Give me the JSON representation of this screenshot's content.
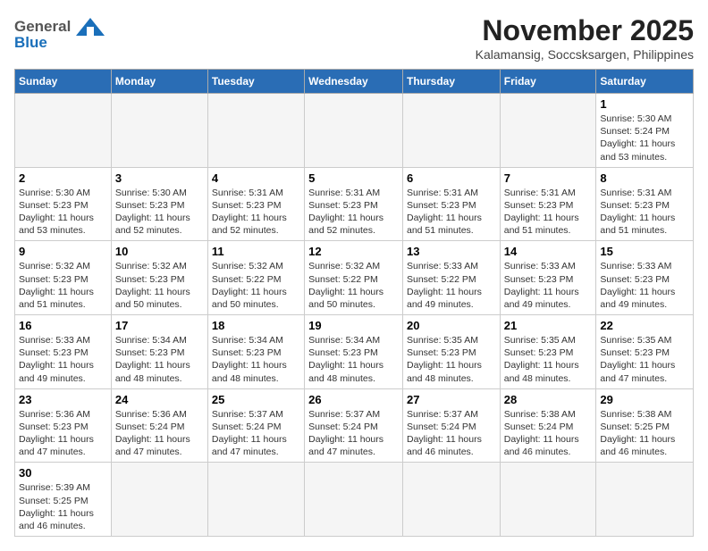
{
  "header": {
    "logo_general": "General",
    "logo_blue": "Blue",
    "month_year": "November 2025",
    "location": "Kalamansig, Soccsksargen, Philippines"
  },
  "weekdays": [
    "Sunday",
    "Monday",
    "Tuesday",
    "Wednesday",
    "Thursday",
    "Friday",
    "Saturday"
  ],
  "weeks": [
    [
      {
        "day": "",
        "info": ""
      },
      {
        "day": "",
        "info": ""
      },
      {
        "day": "",
        "info": ""
      },
      {
        "day": "",
        "info": ""
      },
      {
        "day": "",
        "info": ""
      },
      {
        "day": "",
        "info": ""
      },
      {
        "day": "1",
        "info": "Sunrise: 5:30 AM\nSunset: 5:24 PM\nDaylight: 11 hours\nand 53 minutes."
      }
    ],
    [
      {
        "day": "2",
        "info": "Sunrise: 5:30 AM\nSunset: 5:23 PM\nDaylight: 11 hours\nand 53 minutes."
      },
      {
        "day": "3",
        "info": "Sunrise: 5:30 AM\nSunset: 5:23 PM\nDaylight: 11 hours\nand 52 minutes."
      },
      {
        "day": "4",
        "info": "Sunrise: 5:31 AM\nSunset: 5:23 PM\nDaylight: 11 hours\nand 52 minutes."
      },
      {
        "day": "5",
        "info": "Sunrise: 5:31 AM\nSunset: 5:23 PM\nDaylight: 11 hours\nand 52 minutes."
      },
      {
        "day": "6",
        "info": "Sunrise: 5:31 AM\nSunset: 5:23 PM\nDaylight: 11 hours\nand 51 minutes."
      },
      {
        "day": "7",
        "info": "Sunrise: 5:31 AM\nSunset: 5:23 PM\nDaylight: 11 hours\nand 51 minutes."
      },
      {
        "day": "8",
        "info": "Sunrise: 5:31 AM\nSunset: 5:23 PM\nDaylight: 11 hours\nand 51 minutes."
      }
    ],
    [
      {
        "day": "9",
        "info": "Sunrise: 5:32 AM\nSunset: 5:23 PM\nDaylight: 11 hours\nand 51 minutes."
      },
      {
        "day": "10",
        "info": "Sunrise: 5:32 AM\nSunset: 5:23 PM\nDaylight: 11 hours\nand 50 minutes."
      },
      {
        "day": "11",
        "info": "Sunrise: 5:32 AM\nSunset: 5:22 PM\nDaylight: 11 hours\nand 50 minutes."
      },
      {
        "day": "12",
        "info": "Sunrise: 5:32 AM\nSunset: 5:22 PM\nDaylight: 11 hours\nand 50 minutes."
      },
      {
        "day": "13",
        "info": "Sunrise: 5:33 AM\nSunset: 5:22 PM\nDaylight: 11 hours\nand 49 minutes."
      },
      {
        "day": "14",
        "info": "Sunrise: 5:33 AM\nSunset: 5:23 PM\nDaylight: 11 hours\nand 49 minutes."
      },
      {
        "day": "15",
        "info": "Sunrise: 5:33 AM\nSunset: 5:23 PM\nDaylight: 11 hours\nand 49 minutes."
      }
    ],
    [
      {
        "day": "16",
        "info": "Sunrise: 5:33 AM\nSunset: 5:23 PM\nDaylight: 11 hours\nand 49 minutes."
      },
      {
        "day": "17",
        "info": "Sunrise: 5:34 AM\nSunset: 5:23 PM\nDaylight: 11 hours\nand 48 minutes."
      },
      {
        "day": "18",
        "info": "Sunrise: 5:34 AM\nSunset: 5:23 PM\nDaylight: 11 hours\nand 48 minutes."
      },
      {
        "day": "19",
        "info": "Sunrise: 5:34 AM\nSunset: 5:23 PM\nDaylight: 11 hours\nand 48 minutes."
      },
      {
        "day": "20",
        "info": "Sunrise: 5:35 AM\nSunset: 5:23 PM\nDaylight: 11 hours\nand 48 minutes."
      },
      {
        "day": "21",
        "info": "Sunrise: 5:35 AM\nSunset: 5:23 PM\nDaylight: 11 hours\nand 48 minutes."
      },
      {
        "day": "22",
        "info": "Sunrise: 5:35 AM\nSunset: 5:23 PM\nDaylight: 11 hours\nand 47 minutes."
      }
    ],
    [
      {
        "day": "23",
        "info": "Sunrise: 5:36 AM\nSunset: 5:23 PM\nDaylight: 11 hours\nand 47 minutes."
      },
      {
        "day": "24",
        "info": "Sunrise: 5:36 AM\nSunset: 5:24 PM\nDaylight: 11 hours\nand 47 minutes."
      },
      {
        "day": "25",
        "info": "Sunrise: 5:37 AM\nSunset: 5:24 PM\nDaylight: 11 hours\nand 47 minutes."
      },
      {
        "day": "26",
        "info": "Sunrise: 5:37 AM\nSunset: 5:24 PM\nDaylight: 11 hours\nand 47 minutes."
      },
      {
        "day": "27",
        "info": "Sunrise: 5:37 AM\nSunset: 5:24 PM\nDaylight: 11 hours\nand 46 minutes."
      },
      {
        "day": "28",
        "info": "Sunrise: 5:38 AM\nSunset: 5:24 PM\nDaylight: 11 hours\nand 46 minutes."
      },
      {
        "day": "29",
        "info": "Sunrise: 5:38 AM\nSunset: 5:25 PM\nDaylight: 11 hours\nand 46 minutes."
      }
    ],
    [
      {
        "day": "30",
        "info": "Sunrise: 5:39 AM\nSunset: 5:25 PM\nDaylight: 11 hours\nand 46 minutes."
      },
      {
        "day": "",
        "info": ""
      },
      {
        "day": "",
        "info": ""
      },
      {
        "day": "",
        "info": ""
      },
      {
        "day": "",
        "info": ""
      },
      {
        "day": "",
        "info": ""
      },
      {
        "day": "",
        "info": ""
      }
    ]
  ]
}
